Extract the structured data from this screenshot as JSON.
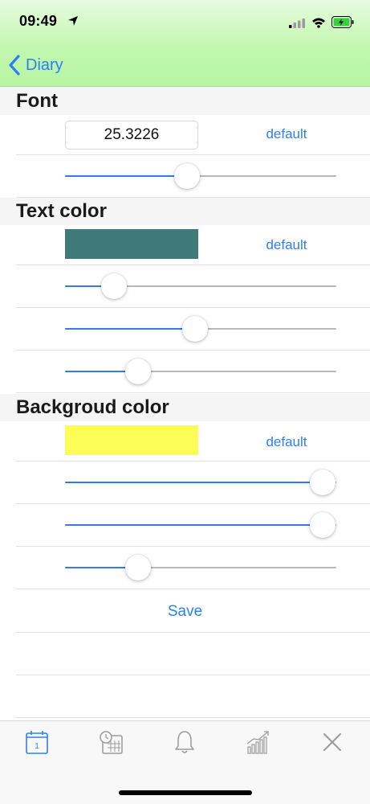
{
  "status": {
    "time": "09:49"
  },
  "nav": {
    "back_label": "Diary"
  },
  "font": {
    "header": "Font",
    "value": "25.3226",
    "default_label": "default",
    "slider": 0.45
  },
  "text_color": {
    "header": "Text color",
    "swatch": "#407a78",
    "default_label": "default",
    "sliders": [
      0.18,
      0.48,
      0.27
    ]
  },
  "background_color": {
    "header": "Backgroud color",
    "swatch": "#fdfd58",
    "default_label": "default",
    "sliders": [
      0.95,
      0.95,
      0.27
    ]
  },
  "save_label": "Save",
  "colors": {
    "accent": "#2f7ef4",
    "nav_green": "#b6f6a4"
  },
  "tabs": [
    "calendar-icon",
    "history-calendar-icon",
    "bell-icon",
    "chart-icon",
    "close-icon"
  ]
}
